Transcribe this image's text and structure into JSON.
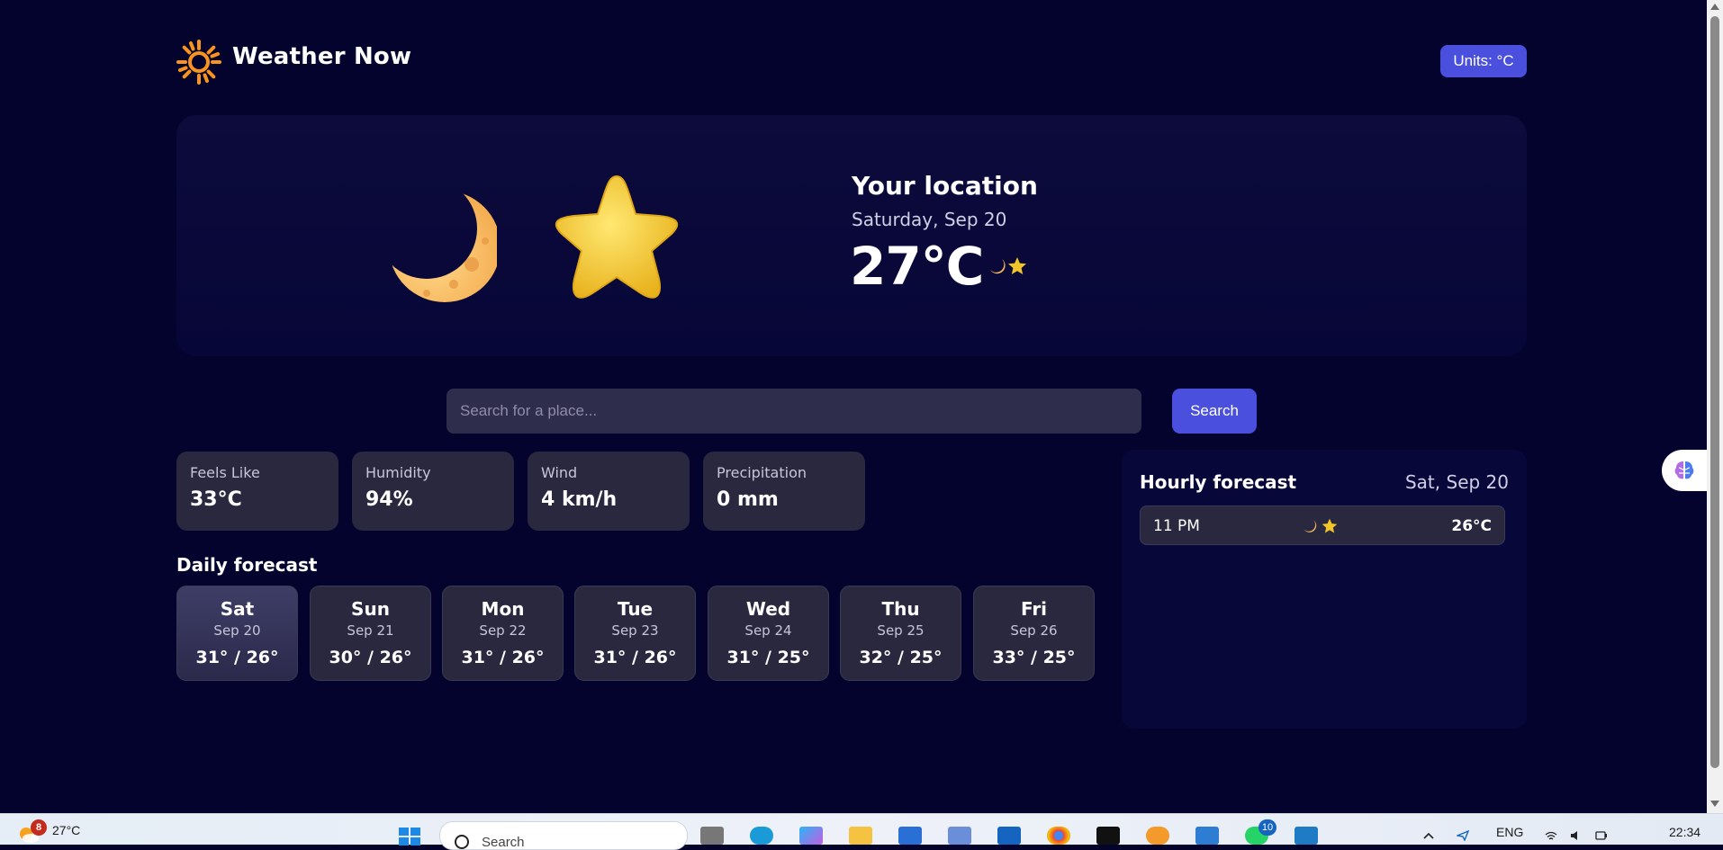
{
  "app": {
    "title": "Weather Now",
    "units_label": "Units: °C"
  },
  "current": {
    "location": "Your location",
    "date": "Saturday, Sep 20",
    "temperature": "27°C",
    "condition_icons": [
      "crescent-moon-icon",
      "star-icon"
    ]
  },
  "search": {
    "placeholder": "Search for a place...",
    "button_label": "Search"
  },
  "stats": [
    {
      "label": "Feels Like",
      "value": "33°C"
    },
    {
      "label": "Humidity",
      "value": "94%"
    },
    {
      "label": "Wind",
      "value": "4 km/h"
    },
    {
      "label": "Precipitation",
      "value": "0 mm"
    }
  ],
  "daily": {
    "title": "Daily forecast",
    "days": [
      {
        "day": "Sat",
        "date": "Sep 20",
        "range": "31° / 26°"
      },
      {
        "day": "Sun",
        "date": "Sep 21",
        "range": "30° / 26°"
      },
      {
        "day": "Mon",
        "date": "Sep 22",
        "range": "31° / 26°"
      },
      {
        "day": "Tue",
        "date": "Sep 23",
        "range": "31° / 26°"
      },
      {
        "day": "Wed",
        "date": "Sep 24",
        "range": "31° / 25°"
      },
      {
        "day": "Thu",
        "date": "Sep 25",
        "range": "32° / 25°"
      },
      {
        "day": "Fri",
        "date": "Sep 26",
        "range": "33° / 25°"
      }
    ]
  },
  "hourly": {
    "title": "Hourly forecast",
    "date": "Sat, Sep 20",
    "rows": [
      {
        "time": "11 PM",
        "temp": "26°C"
      }
    ]
  },
  "taskbar": {
    "weather_badge": "8",
    "weather_temp": "27°C",
    "search_label": "Search",
    "whatsapp_badge": "10",
    "language": "ENG",
    "time": "22:34"
  },
  "colors": {
    "background": "#04032e",
    "accent": "#4a50dd",
    "card": "#29283f",
    "sun": "#f7931e",
    "star": "#f2c52a"
  }
}
